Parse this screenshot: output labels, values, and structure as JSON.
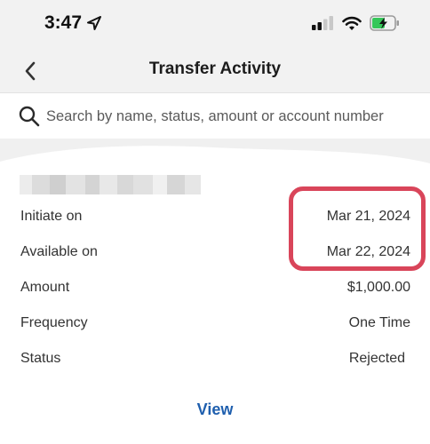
{
  "status_bar": {
    "time": "3:47",
    "icons": [
      "location-arrow-icon",
      "signal-icon",
      "wifi-icon",
      "battery-charging-icon"
    ]
  },
  "nav": {
    "title": "Transfer Activity",
    "back_icon": "chevron-left-icon"
  },
  "search": {
    "placeholder": "Search by name, status, amount or account number",
    "value": "",
    "icon": "search-icon"
  },
  "transfer": {
    "details": [
      {
        "label": "Initiate on",
        "value": "Mar 21, 2024"
      },
      {
        "label": "Available on",
        "value": "Mar 22, 2024"
      },
      {
        "label": "Amount",
        "value": "$1,000.00"
      },
      {
        "label": "Frequency",
        "value": "One Time"
      },
      {
        "label": "Status",
        "value": "Rejected"
      }
    ],
    "view_label": "View"
  },
  "colors": {
    "highlight": "#d9455a",
    "link": "#1f5fae",
    "battery_charge": "#35c759",
    "header_bg": "#f2f2f2"
  }
}
